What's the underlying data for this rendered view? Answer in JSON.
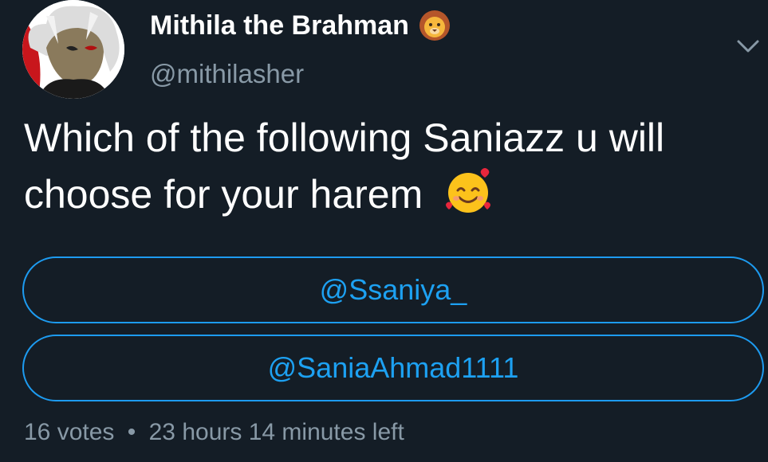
{
  "author": {
    "display_name": "Mithila the Brahman",
    "name_emoji": "lion-face-icon",
    "handle": "@mithilasher"
  },
  "tweet": {
    "text_line1": "Which of the following Saniazz u will",
    "text_line2": "choose for your harem",
    "text_emoji": "smiling-face-with-hearts-icon"
  },
  "poll": {
    "options": [
      {
        "label": "@Ssaniya_"
      },
      {
        "label": "@SaniaAhmad1111"
      }
    ],
    "votes": "16 votes",
    "separator": "•",
    "time_left": "23 hours 14 minutes left"
  },
  "colors": {
    "background": "#141d26",
    "accent": "#1da1f2",
    "secondary_text": "#8899a6"
  }
}
